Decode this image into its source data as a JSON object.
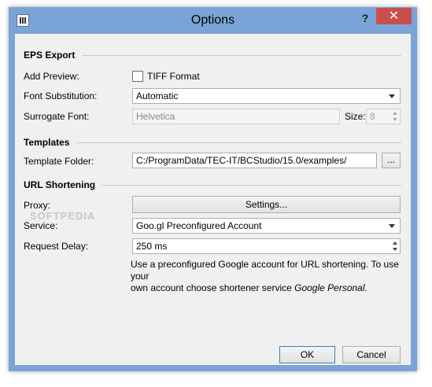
{
  "window": {
    "title": "Options",
    "help_glyph": "?",
    "close_glyph": "✕",
    "app_icon": "barcode-icon"
  },
  "eps_export": {
    "section_label": "EPS Export",
    "add_preview_label": "Add Preview:",
    "tiff_checkbox_label": "TIFF Format",
    "tiff_checked": false,
    "font_substitution_label": "Font Substitution:",
    "font_substitution_value": "Automatic",
    "surrogate_font_label": "Surrogate Font:",
    "surrogate_font_value": "Helvetica",
    "size_label": "Size:",
    "size_value": "8"
  },
  "templates": {
    "section_label": "Templates",
    "folder_label": "Template Folder:",
    "folder_value": "C:/ProgramData/TEC-IT/BCStudio/15.0/examples/",
    "browse_label": "..."
  },
  "url_shortening": {
    "section_label": "URL Shortening",
    "proxy_label": "Proxy:",
    "settings_button_label": "Settings...",
    "service_label": "Service:",
    "service_value": "Goo.gl Preconfigured Account",
    "request_delay_label": "Request Delay:",
    "request_delay_value": "250 ms",
    "note_line1": "Use a preconfigured Google account for URL shortening. To use your",
    "note_line2_prefix": "own account choose shortener service ",
    "note_line2_italic": "Google Personal",
    "note_line2_suffix": "."
  },
  "buttons": {
    "ok_label": "OK",
    "cancel_label": "Cancel"
  },
  "watermark": "SOFTPEDIA"
}
